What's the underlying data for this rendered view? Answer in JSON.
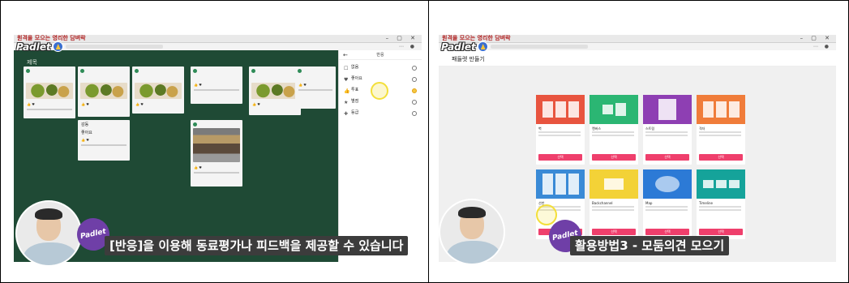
{
  "left": {
    "window_title": "원격을 모으는 영리한 담벼락",
    "logo": "Padlet",
    "board": {
      "title": "제목",
      "subtitle": "",
      "columns": [
        {
          "author": "",
          "text": "",
          "reactions": "",
          "has_image": true
        },
        {
          "author": "",
          "text": "",
          "reactions": "",
          "has_image": true
        },
        {
          "author": "",
          "text": "",
          "reactions": "",
          "has_image": true
        },
        {
          "author": "",
          "text": "",
          "reactions": "",
          "has_image": false
        },
        {
          "author": "",
          "text": "",
          "reactions": "",
          "has_image": true
        },
        {
          "author": "",
          "text": "",
          "reactions": "",
          "has_image": false
        }
      ],
      "extra_column": {
        "text1": "감동",
        "text2": "좋아요"
      }
    },
    "reactions_panel": {
      "title": "반응",
      "back_icon": "arrow-left-icon",
      "options": [
        {
          "label": "없음",
          "icon": "none-icon",
          "selected": false
        },
        {
          "label": "좋아요",
          "icon": "heart-icon",
          "selected": false
        },
        {
          "label": "투표",
          "icon": "thumbs-icon",
          "selected": true
        },
        {
          "label": "별점",
          "icon": "star-icon",
          "selected": false
        },
        {
          "label": "등급",
          "icon": "grade-icon",
          "selected": false
        }
      ]
    },
    "badge": "Padlet",
    "caption": "[반응]을 이용해 동료평가나 피드백을 제공할 수 있습니다"
  },
  "right": {
    "window_title": "원격을 모으는 영리한 담벼락",
    "logo": "Padlet",
    "page_title": "패들렛 만들기",
    "format_title": "",
    "formats": [
      {
        "name": "벽",
        "color": "#e8543f",
        "select": "선택"
      },
      {
        "name": "캔버스",
        "color": "#2bb673",
        "select": "선택"
      },
      {
        "name": "스트림",
        "color": "#8e3fb3",
        "select": "선택"
      },
      {
        "name": "격자",
        "color": "#f07c3a",
        "select": "선택"
      },
      {
        "name": "선반",
        "color": "#3a8ad6",
        "select": "선택"
      },
      {
        "name": "Backchannel",
        "color": "#f3d237",
        "select": "선택"
      },
      {
        "name": "Map",
        "color": "#2c7ad6",
        "select": "선택"
      },
      {
        "name": "Timeline",
        "color": "#15a39a",
        "select": "선택"
      }
    ],
    "badge": "Padlet",
    "caption": "활용방법3 - 모둠의견 모으기"
  }
}
